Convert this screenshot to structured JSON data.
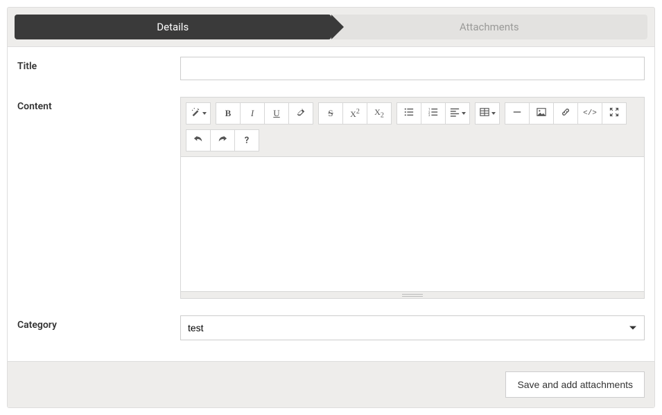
{
  "steps": {
    "details": "Details",
    "attachments": "Attachments"
  },
  "labels": {
    "title": "Title",
    "content": "Content",
    "category": "Category"
  },
  "fields": {
    "title_value": "",
    "category_value": "test"
  },
  "toolbar": {
    "magic": "magic-icon",
    "bold": "B",
    "italic": "I",
    "underline": "U",
    "eraser": "eraser-icon",
    "strike": "S",
    "superscript_base": "X",
    "superscript_sup": "2",
    "subscript_base": "X",
    "subscript_sub": "2",
    "ul": "ul-icon",
    "ol": "ol-icon",
    "align": "align-icon",
    "table": "table-icon",
    "hr": "hr-icon",
    "picture": "picture-icon",
    "link": "link-icon",
    "code": "</>",
    "fullscreen": "fullscreen-icon",
    "undo": "undo-icon",
    "redo": "redo-icon",
    "help": "?"
  },
  "footer": {
    "save": "Save and add attachments"
  }
}
